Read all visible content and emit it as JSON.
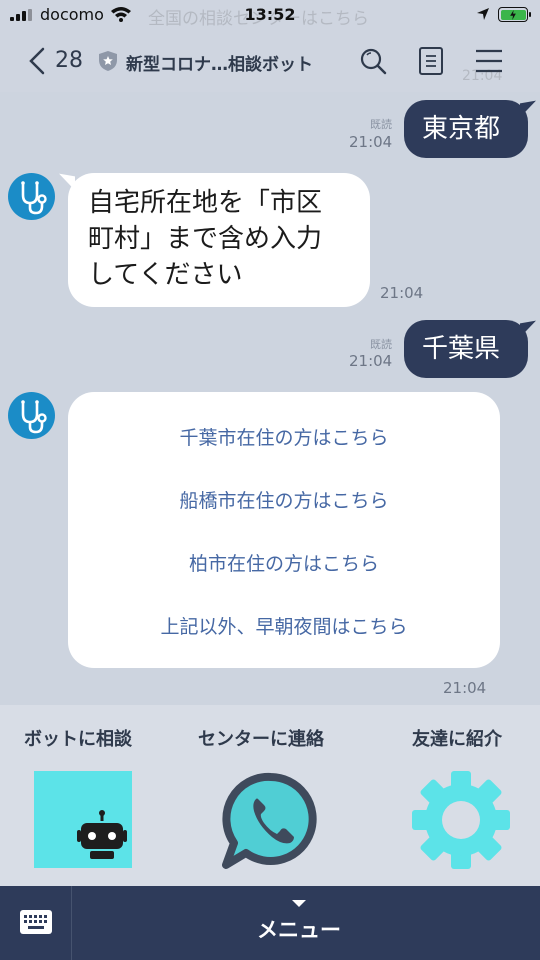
{
  "status": {
    "carrier": "docomo",
    "time": "13:52"
  },
  "ghost": {
    "banner": "全国の相談センターはこちら",
    "time": "21:04"
  },
  "nav": {
    "back_count": "28",
    "title": "新型コロナ…相談ボット"
  },
  "messages": [
    {
      "read": "既読",
      "time": "21:04",
      "text": "東京都"
    },
    {
      "text_lines": [
        "自宅所在地を「市区",
        "町村」まで含め入力",
        "してください"
      ],
      "time": "21:04"
    },
    {
      "read": "既読",
      "time": "21:04",
      "text": "千葉県"
    },
    {
      "links": [
        "千葉市在住の方はこちら",
        "船橋市在住の方はこちら",
        "柏市在住の方はこちら",
        "上記以外、早朝夜間はこちら"
      ],
      "time": "21:04"
    }
  ],
  "rich_menu": {
    "items": [
      {
        "label": "ボットに相談",
        "icon": "robot-icon"
      },
      {
        "label": "センターに連絡",
        "icon": "phone-chat-icon"
      },
      {
        "label": "友達に紹介",
        "icon": "gear-icon"
      }
    ]
  },
  "bottom": {
    "menu_label": "メニュー"
  },
  "colors": {
    "bubble_out": "#2e3b5a",
    "link": "#4668a4",
    "tile": "#5ce3e8",
    "avatar": "#1b8cc7",
    "background": "#cdd4df"
  }
}
